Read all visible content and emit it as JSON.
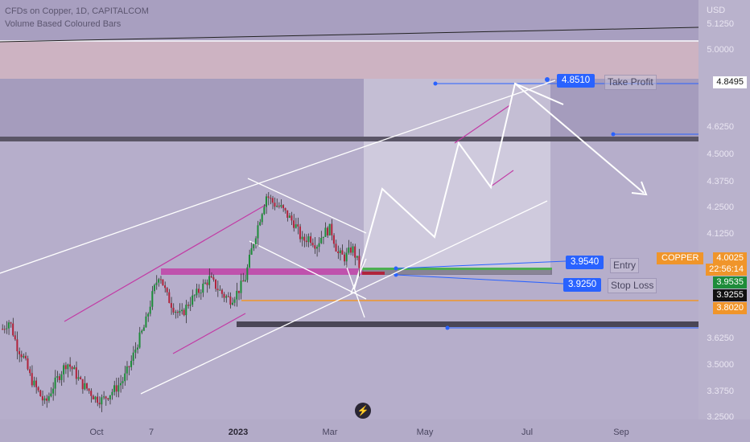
{
  "header": {
    "title": "CFDs on Copper, 1D, CAPITALCOM",
    "indicator": "Volume Based Coloured Bars"
  },
  "colors": {
    "background": "#b6aecb",
    "bull": "#1e8c3a",
    "bear": "#b0243c",
    "accent_blue": "#2962ff",
    "orange": "#f0952a",
    "magenta": "#c23ba5"
  },
  "chart_data": {
    "type": "candlestick",
    "symbol": "COPPER",
    "currency": "USD",
    "x_ticks": [
      "Oct",
      "7",
      "2023",
      "Mar",
      "May",
      "Jul",
      "Sep"
    ],
    "y_ticks": [
      "3.2500",
      "3.3750",
      "3.5000",
      "3.6250",
      "4.1250",
      "4.2500",
      "4.3750",
      "4.5000",
      "4.6250",
      "5.0000",
      "5.1250"
    ],
    "ylim": [
      3.23,
      5.18
    ],
    "levels": {
      "take_profit": 4.851,
      "entry": 3.954,
      "stop_loss": 3.925,
      "support": 3.802,
      "last_price": 4.0025,
      "countdown": "22:56:14",
      "bid": 3.9535,
      "ask": 3.9255,
      "resistance_line": 4.8495
    },
    "labels": {
      "take_profit": "Take Profit",
      "entry": "Entry",
      "stop_loss": "Stop Loss"
    },
    "ohlc_trend": [
      3.66,
      3.7,
      3.58,
      3.52,
      3.42,
      3.36,
      3.3,
      3.38,
      3.44,
      3.5,
      3.46,
      3.4,
      3.37,
      3.33,
      3.32,
      3.35,
      3.38,
      3.42,
      3.5,
      3.6,
      3.68,
      3.82,
      3.93,
      3.82,
      3.76,
      3.72,
      3.78,
      3.82,
      3.86,
      3.9,
      3.86,
      3.82,
      3.8,
      3.84,
      3.9,
      4.05,
      4.18,
      4.3,
      4.26,
      4.24,
      4.2,
      4.16,
      4.08,
      4.1,
      4.06,
      4.12,
      4.14,
      4.02,
      4.0,
      4.05,
      3.96
    ]
  }
}
